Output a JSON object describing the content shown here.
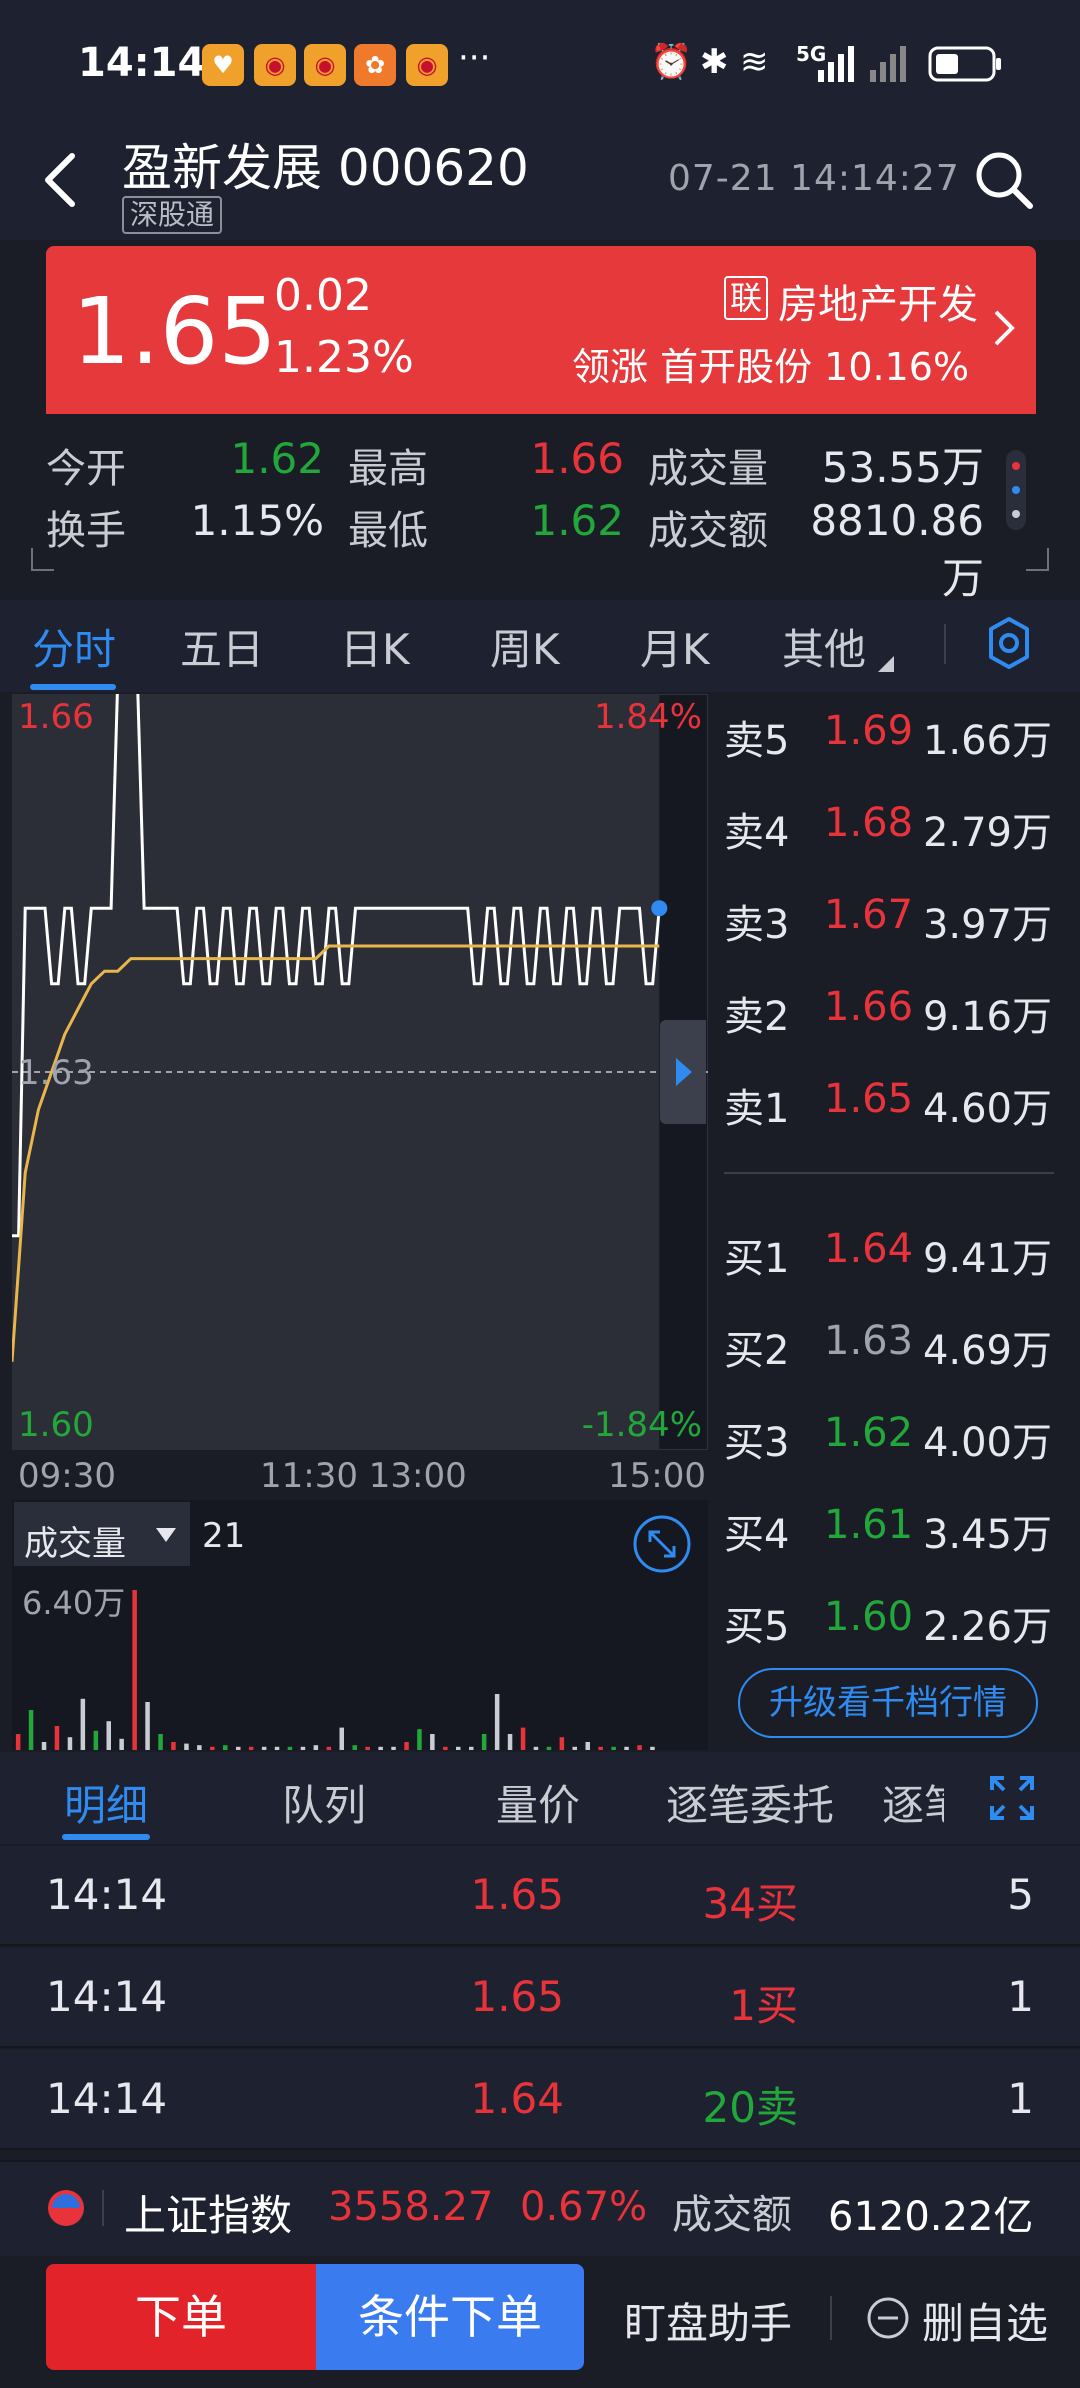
{
  "status_bar": {
    "time": "14:14",
    "more": "···",
    "network": "5G"
  },
  "header": {
    "title": "盈新发展 000620",
    "badge": "深股通",
    "datetime": "07-21 14:14:27"
  },
  "price_banner": {
    "price": "1.65",
    "change": "0.02",
    "change_pct": "1.23%",
    "sector_badge": "联",
    "sector": "房地产开发",
    "leader": "领涨 首开股份 10.16%"
  },
  "stats": {
    "open_label": "今开",
    "open": "1.62",
    "high_label": "最高",
    "high": "1.66",
    "volume_label": "成交量",
    "volume": "53.55万",
    "turnover_label": "换手",
    "turnover": "1.15%",
    "low_label": "最低",
    "low": "1.62",
    "amount_label": "成交额",
    "amount": "8810.86万"
  },
  "chart_tabs": [
    "分时",
    "五日",
    "日K",
    "周K",
    "月K",
    "其他"
  ],
  "chart_labels": {
    "top_price": "1.66",
    "top_pct": "1.84%",
    "mid_price": "1.63",
    "bottom_price": "1.60",
    "bottom_pct": "-1.84%",
    "t_start": "09:30",
    "t_mid": "11:30 13:00",
    "t_end": "15:00",
    "volume_label": "成交量",
    "volume_current": "21",
    "volume_max": "6.40万"
  },
  "chart_data": {
    "type": "line",
    "title": "",
    "ylim": [
      1.6,
      1.66
    ],
    "prev_close": 1.63,
    "series": [
      {
        "values": [
          1.617,
          1.643,
          1.643,
          1.637,
          1.643,
          1.637,
          1.643,
          1.643,
          1.661,
          1.661,
          1.643,
          1.643,
          1.643,
          1.637,
          1.643,
          1.637,
          1.643,
          1.637,
          1.643,
          1.637,
          1.643,
          1.637,
          1.643,
          1.637,
          1.643,
          1.637,
          1.643,
          1.643,
          1.643,
          1.643,
          1.643,
          1.643,
          1.643,
          1.643,
          1.643,
          1.637,
          1.643,
          1.637,
          1.643,
          1.637,
          1.643,
          1.637,
          1.643,
          1.637,
          1.643,
          1.637,
          1.643,
          1.643,
          1.637,
          1.643
        ]
      },
      {
        "values": [
          1.607,
          1.622,
          1.627,
          1.63,
          1.633,
          1.635,
          1.637,
          1.638,
          1.638,
          1.639,
          1.639,
          1.639,
          1.639,
          1.639,
          1.639,
          1.639,
          1.639,
          1.639,
          1.639,
          1.639,
          1.639,
          1.639,
          1.639,
          1.639,
          1.64,
          1.64,
          1.64,
          1.64,
          1.64,
          1.64,
          1.64,
          1.64,
          1.64,
          1.64,
          1.64,
          1.64,
          1.64,
          1.64,
          1.64,
          1.64,
          1.64,
          1.64,
          1.64,
          1.64,
          1.64,
          1.64,
          1.64,
          1.64,
          1.64,
          1.64
        ]
      }
    ],
    "x_fraction_elapsed": 0.93,
    "volume_bars": [
      0.1,
      0.25,
      0.05,
      0.15,
      0.08,
      0.32,
      0.12,
      0.18,
      0.07,
      1.0,
      0.3,
      0.1,
      0.05,
      0.04,
      0.03,
      0.02,
      0.03,
      0.02,
      0.02,
      0.02,
      0.02,
      0.02,
      0.02,
      0.03,
      0.02,
      0.14,
      0.03,
      0.02,
      0.02,
      0.02,
      0.05,
      0.13,
      0.1,
      0.02,
      0.02,
      0.02,
      0.1,
      0.35,
      0.1,
      0.14,
      0.02,
      0.02,
      0.08,
      0.02,
      0.05,
      0.02,
      0.02,
      0.02,
      0.03,
      0.02
    ]
  },
  "order_book": {
    "asks": [
      {
        "label": "卖5",
        "price": "1.69",
        "vol": "1.66万",
        "color": "red"
      },
      {
        "label": "卖4",
        "price": "1.68",
        "vol": "2.79万",
        "color": "red"
      },
      {
        "label": "卖3",
        "price": "1.67",
        "vol": "3.97万",
        "color": "red"
      },
      {
        "label": "卖2",
        "price": "1.66",
        "vol": "9.16万",
        "color": "red"
      },
      {
        "label": "卖1",
        "price": "1.65",
        "vol": "4.60万",
        "color": "red"
      }
    ],
    "bids": [
      {
        "label": "买1",
        "price": "1.64",
        "vol": "9.41万",
        "color": "red"
      },
      {
        "label": "买2",
        "price": "1.63",
        "vol": "4.69万",
        "color": "grey"
      },
      {
        "label": "买3",
        "price": "1.62",
        "vol": "4.00万",
        "color": "green"
      },
      {
        "label": "买4",
        "price": "1.61",
        "vol": "3.45万",
        "color": "green"
      },
      {
        "label": "买5",
        "price": "1.60",
        "vol": "2.26万",
        "color": "green"
      }
    ],
    "upgrade": "升级看千档行情"
  },
  "detail_tabs": [
    "明细",
    "队列",
    "量价",
    "逐笔委托",
    "逐笔"
  ],
  "trades": [
    {
      "time": "14:14",
      "price": "1.65",
      "vol": "34买",
      "side": "buy",
      "count": "5"
    },
    {
      "time": "14:14",
      "price": "1.65",
      "vol": "1买",
      "side": "buy",
      "count": "1"
    },
    {
      "time": "14:14",
      "price": "1.64",
      "vol": "20卖",
      "side": "sell",
      "count": "1"
    }
  ],
  "index_bar": {
    "name": "上证指数",
    "value": "3558.27",
    "pct": "0.67%",
    "amount_label": "成交额",
    "amount": "6120.22亿"
  },
  "bottom_bar": {
    "order": "下单",
    "conditional": "条件下单",
    "monitor": "盯盘助手",
    "remove": "删自选"
  }
}
